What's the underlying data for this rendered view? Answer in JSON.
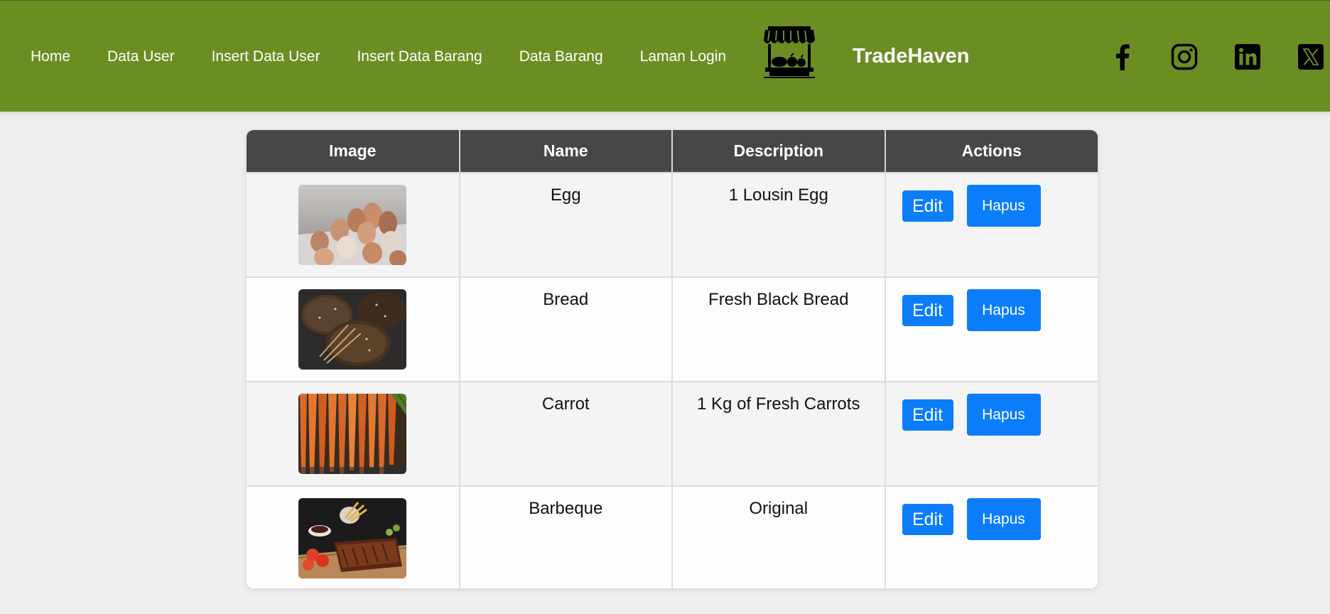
{
  "nav": {
    "links": [
      "Home",
      "Data User",
      "Insert Data User",
      "Insert Data Barang",
      "Data Barang",
      "Laman Login"
    ],
    "brand_name": "TradeHaven",
    "brand_logo_icon": "market-stall-icon",
    "socials": [
      "facebook-icon",
      "instagram-icon",
      "linkedin-icon",
      "x-icon"
    ],
    "bg_color": "#6b8e23"
  },
  "table": {
    "headers": [
      "Image",
      "Name",
      "Description",
      "Actions"
    ],
    "rows": [
      {
        "image": "eggs-photo",
        "name": "Egg",
        "description": "1 Lousin Egg",
        "edit": "Edit",
        "delete": "Hapus"
      },
      {
        "image": "bread-photo",
        "name": "Bread",
        "description": "Fresh Black Bread",
        "edit": "Edit",
        "delete": "Hapus"
      },
      {
        "image": "carrots-photo",
        "name": "Carrot",
        "description": "1 Kg of Fresh Carrots",
        "edit": "Edit",
        "delete": "Hapus"
      },
      {
        "image": "barbeque-photo",
        "name": "Barbeque",
        "description": "Original",
        "edit": "Edit",
        "delete": "Hapus"
      }
    ],
    "header_bg": "#474747",
    "button_color": "#0b7dfa"
  }
}
